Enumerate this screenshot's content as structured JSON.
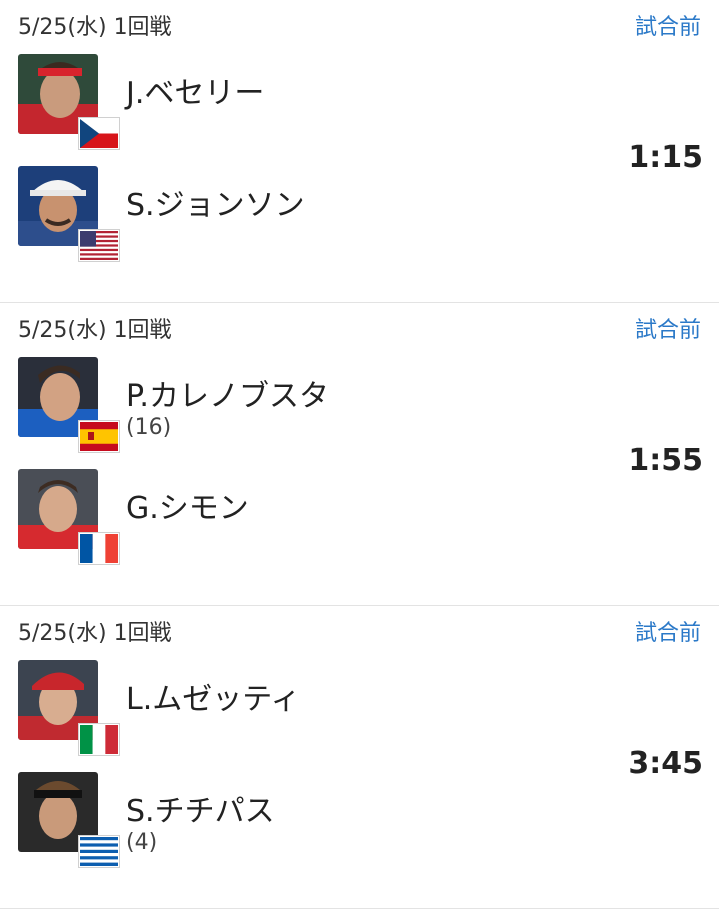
{
  "matches": [
    {
      "date": "5/25(水) 1回戦",
      "status": "試合前",
      "time": "1:15",
      "players": [
        {
          "name": "J.ベセリー",
          "seed": "",
          "flag": "czech-flag-icon",
          "avatar": "player-photo"
        },
        {
          "name": "S.ジョンソン",
          "seed": "",
          "flag": "usa-flag-icon",
          "avatar": "player-photo"
        }
      ]
    },
    {
      "date": "5/25(水) 1回戦",
      "status": "試合前",
      "time": "1:55",
      "players": [
        {
          "name": "P.カレノブスタ",
          "seed": "(16)",
          "flag": "spain-flag-icon",
          "avatar": "player-photo"
        },
        {
          "name": "G.シモン",
          "seed": "",
          "flag": "france-flag-icon",
          "avatar": "player-photo"
        }
      ]
    },
    {
      "date": "5/25(水) 1回戦",
      "status": "試合前",
      "time": "3:45",
      "players": [
        {
          "name": "L.ムゼッティ",
          "seed": "",
          "flag": "italy-flag-icon",
          "avatar": "player-photo"
        },
        {
          "name": "S.チチパス",
          "seed": "(4)",
          "flag": "greece-flag-icon",
          "avatar": "player-photo"
        }
      ]
    }
  ],
  "colors": {
    "status_blue": "#2b79c8",
    "divider": "#e3e3e3"
  }
}
